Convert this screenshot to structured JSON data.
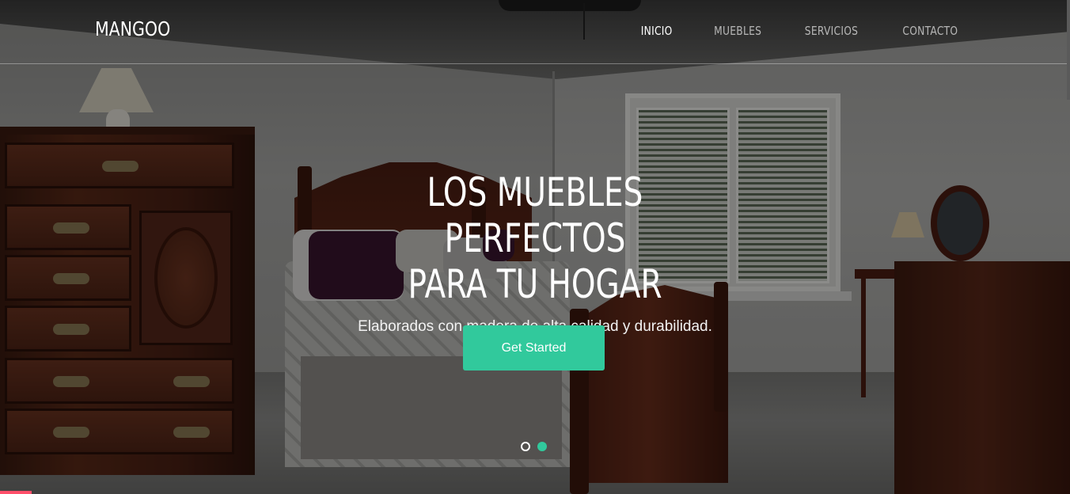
{
  "brand": {
    "name": "MANGOO"
  },
  "nav": {
    "items": [
      {
        "label": "INICIO",
        "active": true
      },
      {
        "label": "MUEBLES",
        "active": false
      },
      {
        "label": "SERVICIOS",
        "active": false
      },
      {
        "label": "CONTACTO",
        "active": false
      }
    ]
  },
  "hero": {
    "title_line1": "LOS MUEBLES PERFECTOS",
    "title_line2": "PARA TU HOGAR",
    "subtitle": "Elaborados con madera de alta calidad y durabilidad.",
    "cta_label": "Get Started",
    "carousel": {
      "slides": 2,
      "active_index": 1
    },
    "background_image": "bedroom-photo"
  },
  "colors": {
    "accent": "#31c99c",
    "text": "#ffffff",
    "loader": "#ff4f6a"
  }
}
